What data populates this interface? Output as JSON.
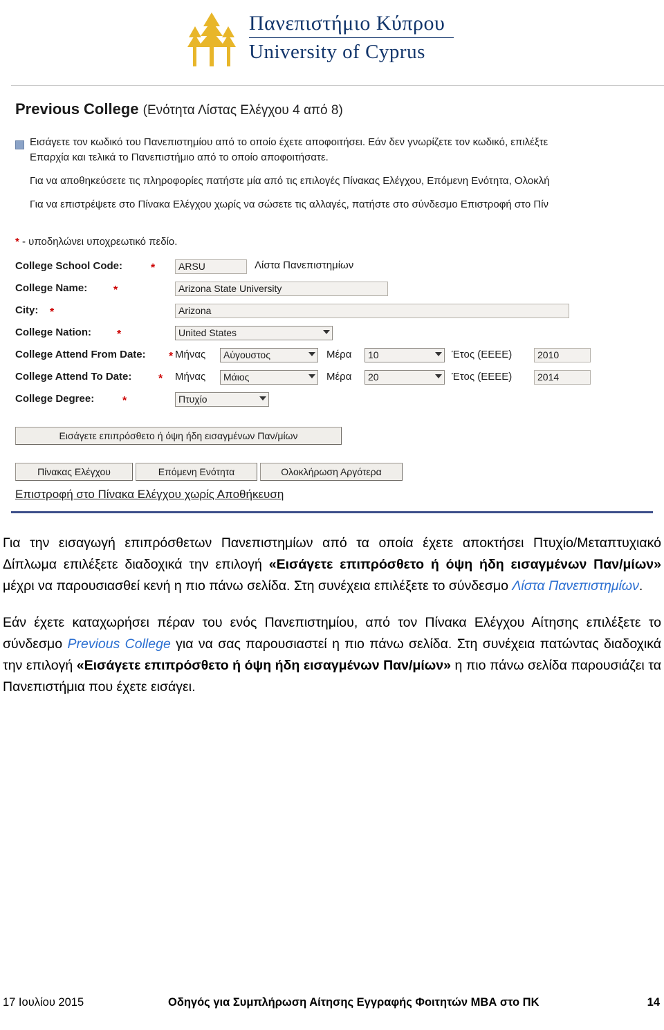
{
  "logo": {
    "greek": "Πανεπιστήμιο Κύπρου",
    "english": "University of Cyprus",
    "icon": "tree-logo"
  },
  "screenshot": {
    "title": "Previous College",
    "subtitle": "(Ενότητα Λίστας Ελέγχου 4 από 8)",
    "instructions": [
      "Εισάγετε τον κωδικό του Πανεπιστημίου από το οποίο έχετε αποφοιτήσει. Εάν δεν γνωρίζετε τον κωδικό, επιλέξτε",
      "Επαρχία και τελικά το Πανεπιστήμιο από το οποίο αποφοιτήσατε.",
      "Για να αποθηκεύσετε τις πληροφορίες πατήστε μία από τις επιλογές Πίνακας Ελέγχου, Επόμενη Ενότητα, Ολοκλή",
      "Για να επιστρέψετε στο Πίνακα Ελέγχου χωρίς να σώσετε τις αλλαγές, πατήστε στο σύνδεσμο Επιστροφή στο Πίν"
    ],
    "required_note": "- υποδηλώνει υποχρεωτικό πεδίο.",
    "required_star": "*",
    "form": {
      "rows": [
        {
          "label": "College School Code:",
          "required": true,
          "value": "ARSU",
          "side_link": "Λίστα Πανεπιστημίων"
        },
        {
          "label": "College Name:",
          "required": true,
          "value": "Arizona State University"
        },
        {
          "label": "City:",
          "required": true,
          "value": "Arizona"
        },
        {
          "label": "College Nation:",
          "required": true,
          "value": "United States"
        }
      ],
      "attend_from": {
        "label": "College Attend From Date:",
        "required": true,
        "month_label": "Μήνας",
        "month_value": "Αύγουστος",
        "day_label": "Μέρα",
        "day_value": "10",
        "year_label": "Έτος (ΕΕΕΕ)",
        "year_value": "2010"
      },
      "attend_to": {
        "label": "College Attend To Date:",
        "required": true,
        "month_label": "Μήνας",
        "month_value": "Μάιος",
        "day_label": "Μέρα",
        "day_value": "20",
        "year_label": "Έτος (ΕΕΕΕ)",
        "year_value": "2014"
      },
      "degree": {
        "label": "College Degree:",
        "required": true,
        "value": "Πτυχίο"
      }
    },
    "buttons": {
      "add_more": "Εισάγετε επιπρόσθετο ή όψη ήδη εισαγμένων Παν/μίων",
      "dashboard": "Πίνακας Ελέγχου",
      "next_section": "Επόμενη Ενότητα",
      "finish_later": "Ολοκλήρωση Αργότερα"
    },
    "return_link": "Επιστροφή στο Πίνακα Ελέγχου χωρίς Αποθήκευση"
  },
  "body": {
    "p1_part1": "Για την εισαγωγή επιπρόσθετων Πανεπιστημίων από τα οποία έχετε αποκτήσει Πτυχίο/Μεταπτυχιακό Δίπλωμα επιλέξετε διαδοχικά την επιλογή ",
    "p1_bold": "«Εισάγετε επιπρόσθετο ή όψη ήδη εισαγμένων Παν/μίων»",
    "p1_part2": " μέχρι να παρουσιασθεί κενή η πιο πάνω σελίδα. Στη συνέχεια επιλέξετε το σύνδεσμο ",
    "p1_link": "Λίστα Πανεπιστημίων",
    "p1_end": ".",
    "p2_part1": "Εάν έχετε καταχωρήσει πέραν του ενός Πανεπιστημίου, από τον Πίνακα Ελέγχου Αίτησης επιλέξετε το σύνδεσμο ",
    "p2_link": "Previous College",
    "p2_part2": " για να σας παρουσιαστεί η πιο πάνω σελίδα. Στη συνέχεια πατώντας διαδοχικά την επιλογή ",
    "p2_bold": "«Εισάγετε επιπρόσθετο ή όψη ήδη εισαγμένων Παν/μίων»",
    "p2_end": " η πιο πάνω σελίδα παρουσιάζει τα Πανεπιστήμια που έχετε εισάγει."
  },
  "footer": {
    "date": "17 Ιουλίου 2015",
    "title": "Οδηγός για Συμπλήρωση Αίτησης Εγγραφής Φοιτητών ΜΒΑ στο ΠΚ",
    "page": "14"
  }
}
